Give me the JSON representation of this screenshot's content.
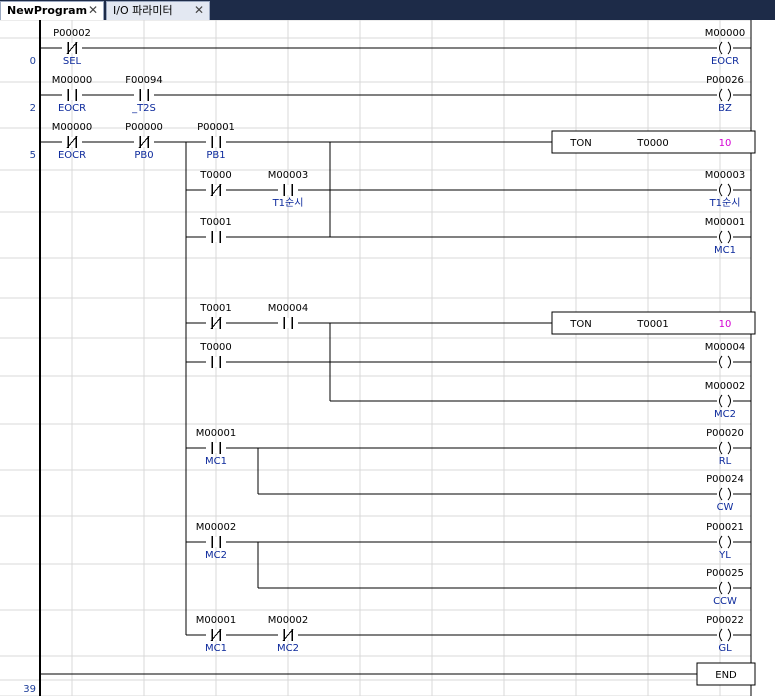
{
  "tabs": [
    {
      "label": "NewProgram",
      "active": true
    },
    {
      "label": "I/O 파라미터",
      "active": false
    }
  ],
  "close_glyph": "✕",
  "colors": {
    "tab_bar": "#1d2b48",
    "address_text": "#000000",
    "comment_text": "#0d2a9c",
    "timer_preset": "#d400d4",
    "step_number": "#1f3f9a",
    "grid": "#d9d9d9",
    "rail": "#000000"
  },
  "step_numbers": [
    {
      "label": "0",
      "row": 1
    },
    {
      "label": "2",
      "row": 2
    },
    {
      "label": "5",
      "row": 3
    },
    {
      "label": "39",
      "row": 17
    }
  ],
  "rungs": [
    {
      "contacts": [
        {
          "address": "P00002",
          "comment": "SEL",
          "type": "NC",
          "col": 1,
          "row": 1
        }
      ],
      "coil": {
        "address": "M00000",
        "comment": "EOCR",
        "row": 1
      }
    },
    {
      "contacts": [
        {
          "address": "M00000",
          "comment": "EOCR",
          "type": "NO",
          "col": 1,
          "row": 2
        },
        {
          "address": "F00094",
          "comment": "_T2S",
          "type": "NO",
          "col": 2,
          "row": 2
        }
      ],
      "coil": {
        "address": "P00026",
        "comment": "BZ",
        "row": 2
      }
    },
    {
      "contacts": [
        {
          "address": "M00000",
          "comment": "EOCR",
          "type": "NC",
          "col": 1,
          "row": 3
        },
        {
          "address": "P00000",
          "comment": "PB0",
          "type": "NC",
          "col": 2,
          "row": 3
        },
        {
          "address": "P00001",
          "comment": "PB1",
          "type": "NO",
          "col": 3,
          "row": 3
        },
        {
          "address": "T0000",
          "comment": "",
          "type": "NC",
          "col": 3,
          "row": 4
        },
        {
          "address": "M00003",
          "comment": "T1순시",
          "type": "NO",
          "col": 4,
          "row": 4
        },
        {
          "address": "T0001",
          "comment": "",
          "type": "NO",
          "col": 3,
          "row": 5
        },
        {
          "address": "T0001",
          "comment": "",
          "type": "NC",
          "col": 3,
          "row": 7
        },
        {
          "address": "M00004",
          "comment": "",
          "type": "NO",
          "col": 4,
          "row": 7
        },
        {
          "address": "T0000",
          "comment": "",
          "type": "NO",
          "col": 3,
          "row": 8
        },
        {
          "address": "M00001",
          "comment": "MC1",
          "type": "NO",
          "col": 3,
          "row": 10
        },
        {
          "address": "M00002",
          "comment": "MC2",
          "type": "NO",
          "col": 3,
          "row": 12
        },
        {
          "address": "M00001",
          "comment": "MC1",
          "type": "NC",
          "col": 3,
          "row": 14
        },
        {
          "address": "M00002",
          "comment": "MC2",
          "type": "NC",
          "col": 4,
          "row": 14
        }
      ],
      "coils": [
        {
          "address": "M00003",
          "comment": "T1순시",
          "row": 4
        },
        {
          "address": "M00001",
          "comment": "MC1",
          "row": 5
        },
        {
          "address": "M00004",
          "comment": "",
          "row": 8
        },
        {
          "address": "M00002",
          "comment": "MC2",
          "row": 9
        },
        {
          "address": "P00020",
          "comment": "RL",
          "row": 10
        },
        {
          "address": "P00024",
          "comment": "CW",
          "row": 11
        },
        {
          "address": "P00021",
          "comment": "YL",
          "row": 12
        },
        {
          "address": "P00025",
          "comment": "CCW",
          "row": 13
        },
        {
          "address": "P00022",
          "comment": "GL",
          "row": 14
        }
      ],
      "timers": [
        {
          "instruction": "TON",
          "timer": "T0000",
          "preset": "10",
          "row": 3
        },
        {
          "instruction": "TON",
          "timer": "T0001",
          "preset": "10",
          "row": 7
        }
      ]
    }
  ],
  "end_instruction": {
    "label": "END",
    "row": 16
  }
}
